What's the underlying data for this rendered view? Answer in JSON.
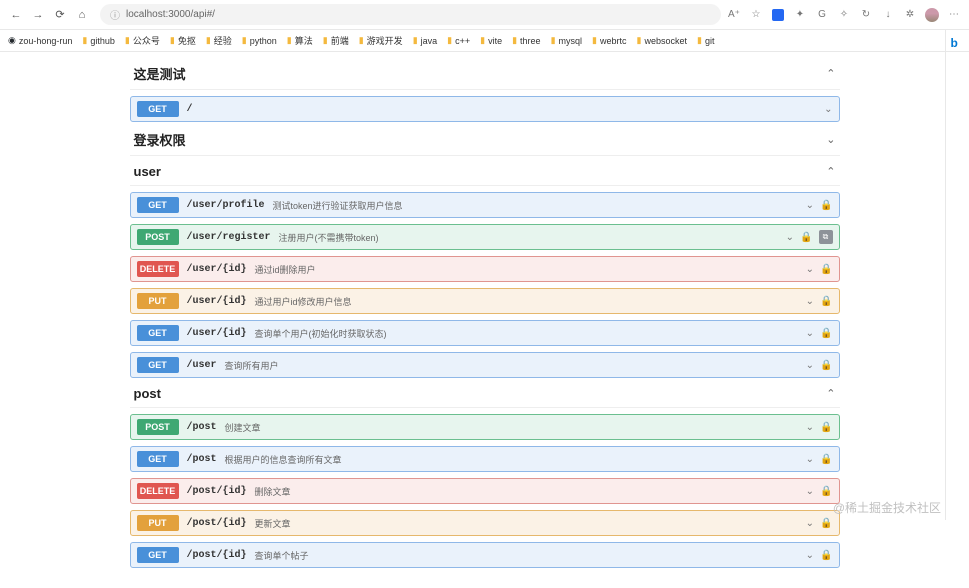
{
  "browser": {
    "url": "localhost:3000/api#/",
    "actions": [
      "A⁺"
    ]
  },
  "bookmarks": [
    {
      "icon": "gh",
      "label": "zou-hong-run"
    },
    {
      "icon": "folder",
      "label": "github"
    },
    {
      "icon": "folder",
      "label": "公众号"
    },
    {
      "icon": "folder",
      "label": "免抠"
    },
    {
      "icon": "folder",
      "label": "经验"
    },
    {
      "icon": "folder",
      "label": "python"
    },
    {
      "icon": "folder",
      "label": "算法"
    },
    {
      "icon": "folder",
      "label": "前端"
    },
    {
      "icon": "folder",
      "label": "游戏开发"
    },
    {
      "icon": "folder",
      "label": "java"
    },
    {
      "icon": "folder",
      "label": "c++"
    },
    {
      "icon": "folder",
      "label": "vite"
    },
    {
      "icon": "folder",
      "label": "three"
    },
    {
      "icon": "folder",
      "label": "mysql"
    },
    {
      "icon": "folder",
      "label": "webrtc"
    },
    {
      "icon": "folder",
      "label": "websocket"
    },
    {
      "icon": "folder",
      "label": "git"
    }
  ],
  "sections": [
    {
      "title": "这是测试",
      "expanded": true,
      "ops": [
        {
          "method": "GET",
          "path": "/",
          "desc": "",
          "lock": false,
          "copy": false
        }
      ]
    },
    {
      "title": "登录权限",
      "expanded": false,
      "ops": []
    },
    {
      "title": "user",
      "expanded": true,
      "ops": [
        {
          "method": "GET",
          "path": "/user/profile",
          "desc": "测试token进行验证获取用户信息",
          "lock": true,
          "copy": false
        },
        {
          "method": "POST",
          "path": "/user/register",
          "desc": "注册用户(不需携带token)",
          "lock": true,
          "copy": true
        },
        {
          "method": "DELETE",
          "path": "/user/{id}",
          "desc": "通过id删除用户",
          "lock": true,
          "copy": false
        },
        {
          "method": "PUT",
          "path": "/user/{id}",
          "desc": "通过用户id修改用户信息",
          "lock": true,
          "copy": false
        },
        {
          "method": "GET",
          "path": "/user/{id}",
          "desc": "查询单个用户(初始化时获取状态)",
          "lock": true,
          "copy": false
        },
        {
          "method": "GET",
          "path": "/user",
          "desc": "查询所有用户",
          "lock": true,
          "copy": false
        }
      ]
    },
    {
      "title": "post",
      "expanded": true,
      "ops": [
        {
          "method": "POST",
          "path": "/post",
          "desc": "创建文章",
          "lock": true,
          "copy": false
        },
        {
          "method": "GET",
          "path": "/post",
          "desc": "根据用户的信息查询所有文章",
          "lock": true,
          "copy": false
        },
        {
          "method": "DELETE",
          "path": "/post/{id}",
          "desc": "删除文章",
          "lock": true,
          "copy": false
        },
        {
          "method": "PUT",
          "path": "/post/{id}",
          "desc": "更新文章",
          "lock": true,
          "copy": false
        },
        {
          "method": "GET",
          "path": "/post/{id}",
          "desc": "查询单个帖子",
          "lock": true,
          "copy": false
        }
      ]
    }
  ],
  "watermark": "@稀土掘金技术社区"
}
